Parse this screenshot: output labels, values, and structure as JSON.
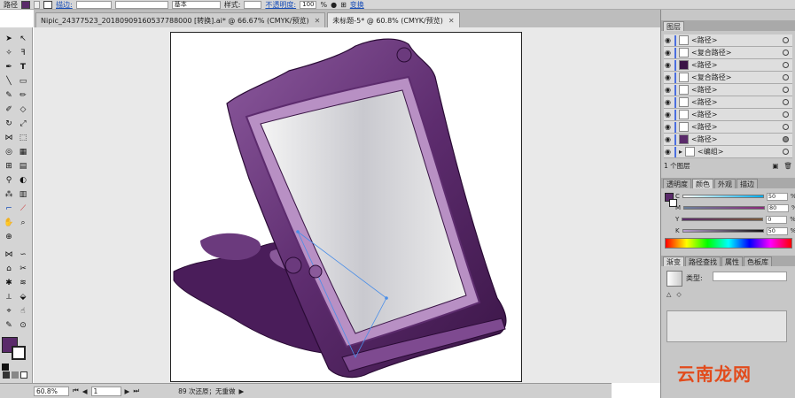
{
  "control_bar": {
    "label_path": "路径",
    "stroke_label": "描边:",
    "stroke_basic": "基本",
    "style_label": "样式:",
    "opacity_label": "不透明度:",
    "opacity_value": "100",
    "opacity_unit": "%",
    "transform_label": "变换",
    "fill_color": "#5a2a6a"
  },
  "tabs": [
    {
      "label": "Nipic_24377523_20180909160537788000 [转换].ai* @ 66.67% (CMYK/预览)",
      "close": "✕"
    },
    {
      "label": "未标题-5* @ 60.8% (CMYK/预览)",
      "close": "✕"
    }
  ],
  "status": {
    "zoom": "60.8%",
    "page": "1",
    "message": "89 次还原；无重做"
  },
  "layers_panel": {
    "tab": "图层",
    "rows": [
      {
        "label": "<路径>",
        "indent": 0
      },
      {
        "label": "<复合路径>",
        "indent": 0
      },
      {
        "label": "<路径>",
        "indent": 0
      },
      {
        "label": "<复合路径>",
        "indent": 0
      },
      {
        "label": "<路径>",
        "indent": 0
      },
      {
        "label": "<路径>",
        "indent": 0
      },
      {
        "label": "<路径>",
        "indent": 0
      },
      {
        "label": "<路径>",
        "indent": 0
      },
      {
        "label": "<路径>",
        "indent": 0
      },
      {
        "label": "<编组>",
        "indent": 0
      }
    ],
    "footer": "1 个图层"
  },
  "color_panel": {
    "tabs": [
      "透明度",
      "颜色",
      "外观",
      "描边"
    ],
    "channels": [
      {
        "name": "C",
        "value": "50",
        "color": "#00aeef"
      },
      {
        "name": "M",
        "value": "80",
        "color": "#ec008c"
      },
      {
        "name": "Y",
        "value": "0",
        "color": "#fff200"
      },
      {
        "name": "K",
        "value": "50",
        "color": "#222222"
      }
    ],
    "unit": "%",
    "swatch": "#5a2a6a"
  },
  "gradient_panel": {
    "tabs": [
      "渐变",
      "路径查找",
      "属性",
      "色板库"
    ],
    "type_label": "类型:"
  },
  "watermark": "云南龙网"
}
